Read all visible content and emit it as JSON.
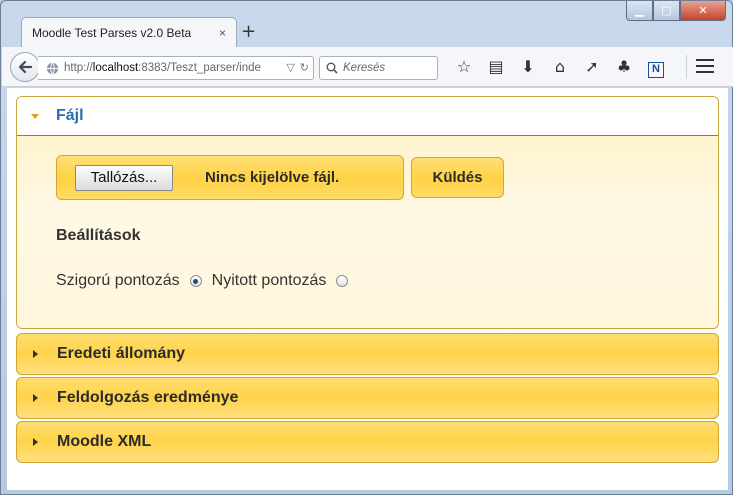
{
  "browser": {
    "tab_title": "Moodle Test Parses v2.0 Beta",
    "tab_close": "×",
    "new_tab": "+",
    "url_prefix": "http://",
    "url_host": "localhost",
    "url_rest": ":8383/Teszt_parser/inde",
    "search_placeholder": "Keresés",
    "window_controls": {
      "minimize": "▁",
      "maximize": "▢",
      "close": "✕"
    }
  },
  "page": {
    "file_panel": {
      "title": "Fájl",
      "browse_label": "Tallózás...",
      "no_file_text": "Nincs kijelölve fájl.",
      "send_label": "Küldés",
      "settings_title": "Beállítások",
      "options": [
        {
          "label": "Szigorú pontozás",
          "checked": true
        },
        {
          "label": "Nyitott pontozás",
          "checked": false
        }
      ]
    },
    "collapsed_panels": [
      {
        "title": "Eredeti állomány"
      },
      {
        "title": "Feldolgozás eredménye"
      },
      {
        "title": "Moodle XML"
      }
    ]
  },
  "colors": {
    "accent_blue": "#2a6fb3",
    "panel_yellow": "#ffd34a",
    "panel_border": "#d0a531"
  }
}
